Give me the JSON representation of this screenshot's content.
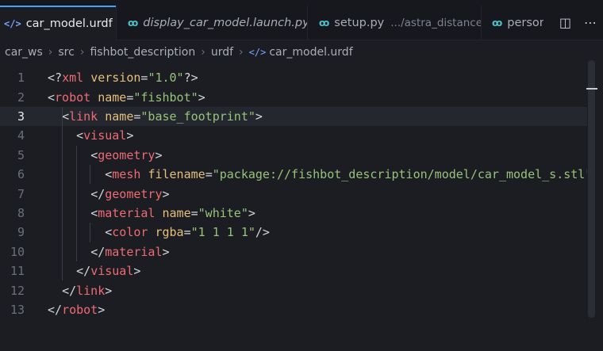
{
  "tabs": [
    {
      "label": "car_model.urdf",
      "icon": "xml-file-icon",
      "active": true
    },
    {
      "label": "display_car_model.launch.py",
      "icon": "python-file-icon",
      "italic": true
    },
    {
      "label": "setup.py",
      "description": ".../astra_distance",
      "icon": "python-file-icon"
    },
    {
      "label": "person_",
      "icon": "python-file-icon"
    }
  ],
  "tab_close_glyph": "×",
  "tab_actions": {
    "split_glyph": "◫",
    "more_glyph": "⋯"
  },
  "breadcrumb": [
    "car_ws",
    "src",
    "fishbot_description",
    "urdf",
    "car_model.urdf"
  ],
  "breadcrumb_sep": "›",
  "editor": {
    "current_line": 3,
    "lines": [
      "<?xml version=\"1.0\"?>",
      "<robot name=\"fishbot\">",
      "  <link name=\"base_footprint\">",
      "    <visual>",
      "      <geometry>",
      "        <mesh filename=\"package://fishbot_description/model/car_model_s.stl\" sca",
      "      </geometry>",
      "      <material name=\"white\">",
      "        <color rgba=\"1 1 1 1\"/>",
      "      </material>",
      "    </visual>",
      "  </link>",
      "</robot>"
    ]
  },
  "colors": {
    "accent": "#3fa3ff",
    "tag": "#ef6b73",
    "attr": "#e5c07b",
    "string": "#98c379"
  }
}
